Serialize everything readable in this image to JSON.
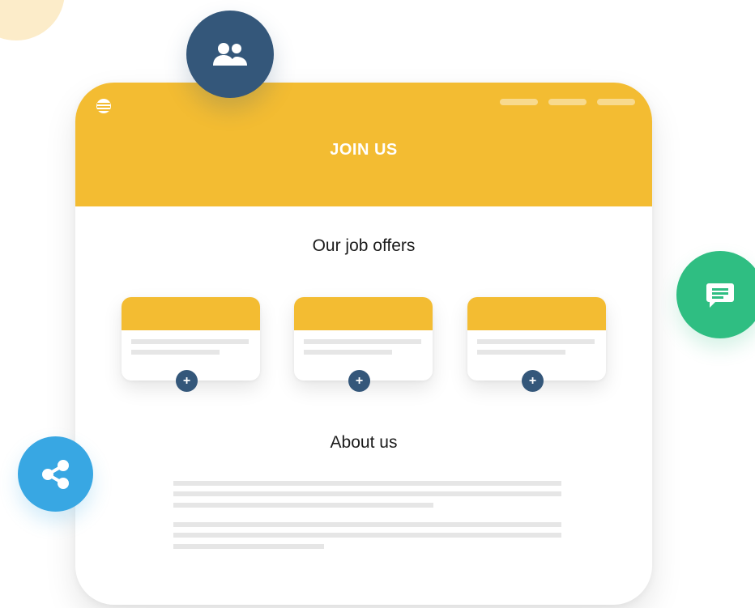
{
  "page": {
    "hero_title": "JOIN US",
    "jobs_title": "Our job offers",
    "about_title": "About us"
  },
  "icons": {
    "people": "people-icon",
    "chat": "chat-icon",
    "share": "share-icon",
    "menu": "menu-icon",
    "plus": "plus-icon"
  },
  "jobs": [
    {
      "action": "+"
    },
    {
      "action": "+"
    },
    {
      "action": "+"
    }
  ],
  "colors": {
    "primary_yellow": "#f3bc32",
    "navy": "#34577a",
    "green": "#2fbe82",
    "blue": "#38a7e3",
    "gray_line": "#e6e6e6"
  }
}
